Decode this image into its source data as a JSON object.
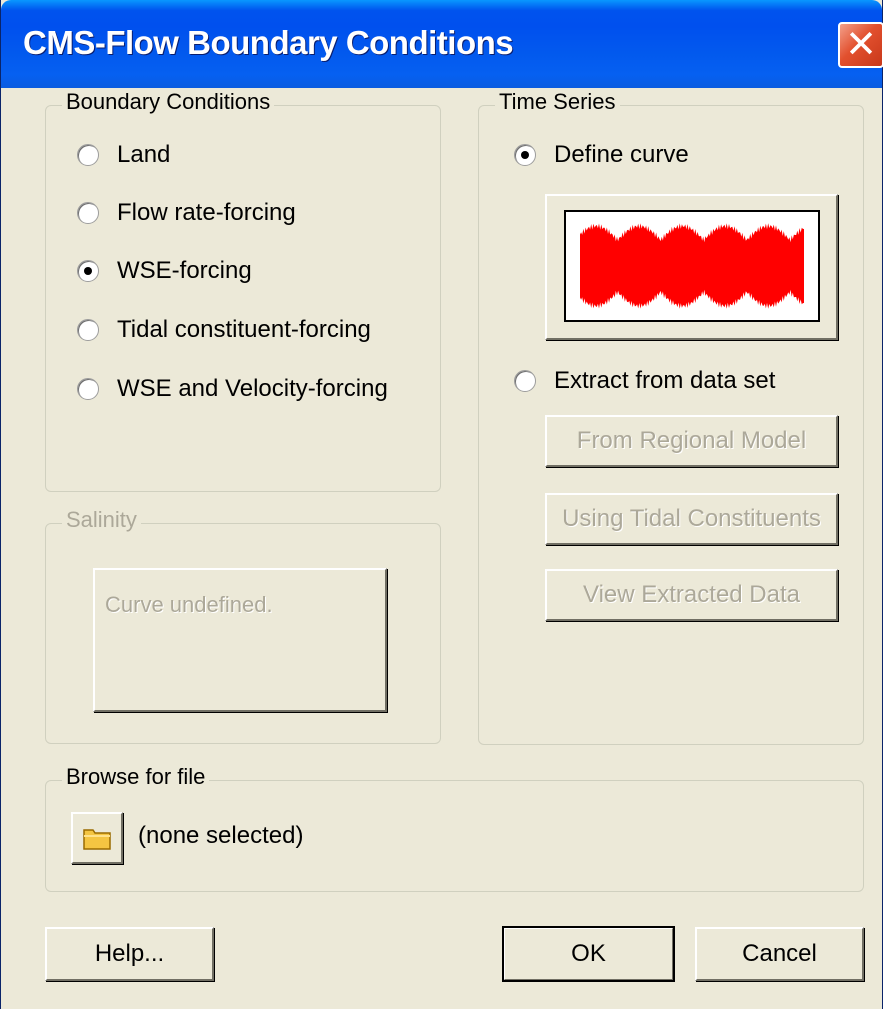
{
  "window": {
    "title": "CMS-Flow Boundary Conditions",
    "close_glyph": "✕"
  },
  "boundary_conditions": {
    "title": "Boundary Conditions",
    "selected": "WSE-forcing",
    "options": [
      "Land",
      "Flow rate-forcing",
      "WSE-forcing",
      "Tidal constituent-forcing",
      "WSE and Velocity-forcing"
    ]
  },
  "salinity": {
    "title": "Salinity",
    "curve_label": "Curve undefined.",
    "enabled": false
  },
  "time_series": {
    "title": "Time Series",
    "selected": "Define curve",
    "define_curve_label": "Define curve",
    "extract_label": "Extract from data set",
    "curve_color": "#FF0000",
    "buttons": {
      "regional": "From Regional Model",
      "tidal": "Using Tidal Constituents",
      "view": "View Extracted Data"
    }
  },
  "browse": {
    "title": "Browse for file",
    "icon": "folder-icon",
    "file": "(none selected)"
  },
  "footer": {
    "help": "Help...",
    "ok": "OK",
    "cancel": "Cancel"
  },
  "colors": {
    "dialog_bg": "#ECE9D8",
    "titlebar": "#0054E3",
    "close": "#E2502E",
    "disabled_text": "#ACA899"
  }
}
